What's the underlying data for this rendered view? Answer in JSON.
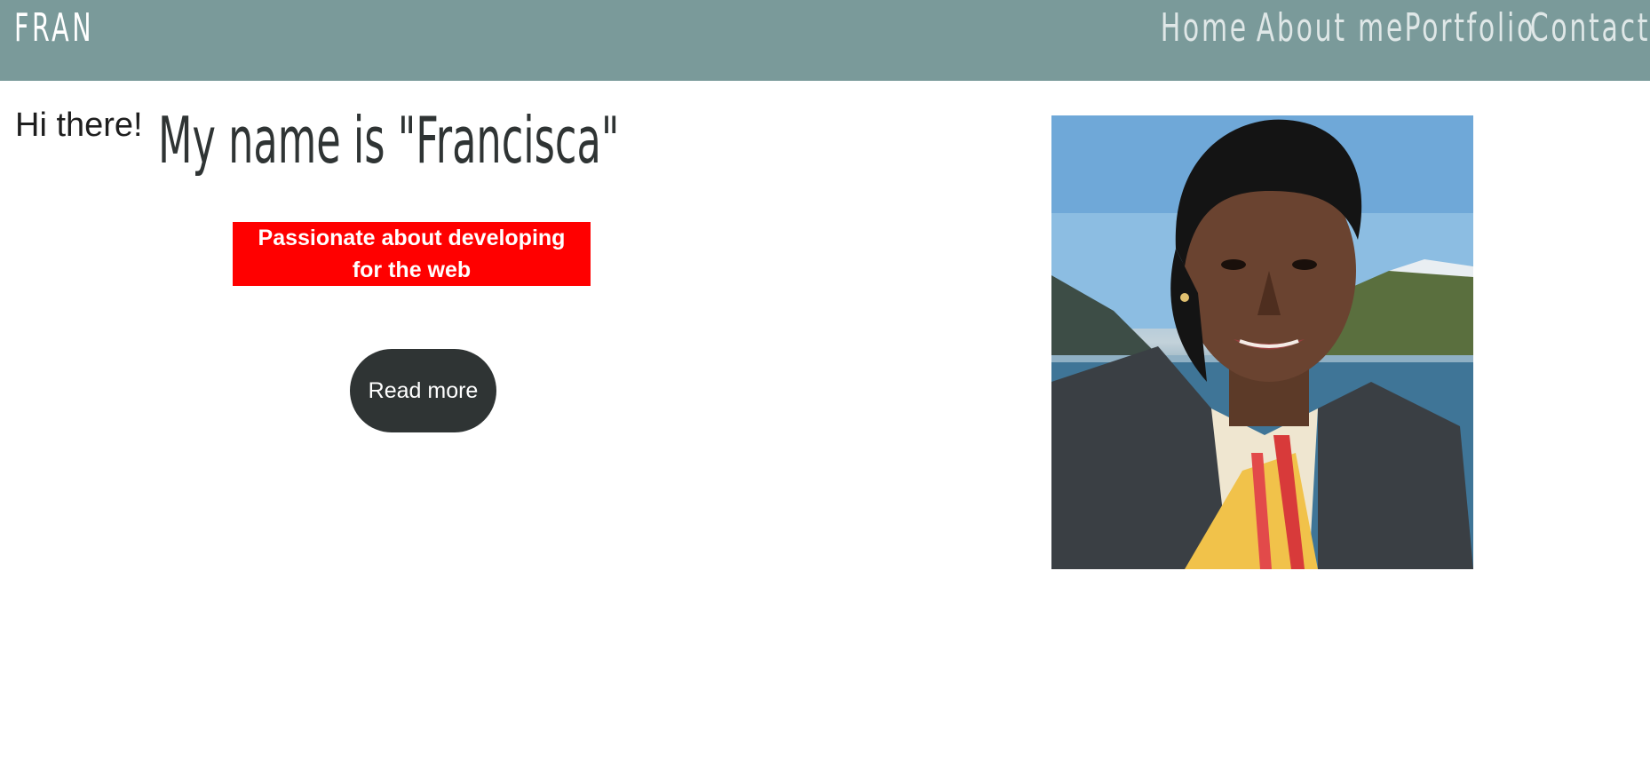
{
  "header": {
    "brand": "FRAN",
    "nav": [
      "Home",
      "About me",
      "Portfolio",
      "Contact"
    ]
  },
  "hero": {
    "greeting": "Hi there!",
    "title": "My name is \"Francisca\"",
    "tagline_line1": "Passionate about developing",
    "tagline_line2": "for the web",
    "button": "Read more"
  },
  "photo": {
    "alt": "Portrait of Francisca"
  },
  "colors": {
    "header_bg": "#7a9a9a",
    "tagline_bg": "#ff0000",
    "button_bg": "#2f3434",
    "title_text": "#2f3434"
  }
}
